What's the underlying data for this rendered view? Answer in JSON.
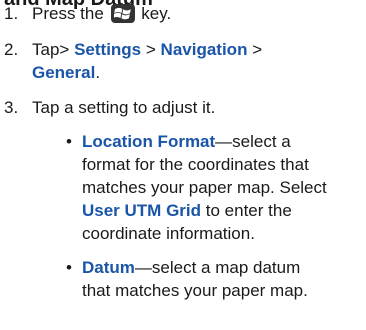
{
  "heading": "and Map Datum",
  "steps": {
    "s1": {
      "num": "1.",
      "pre": "Press the",
      "key_icon": "windows-key-icon",
      "post": "key."
    },
    "s2": {
      "num": "2.",
      "pre": "Tap>",
      "settings": "Settings",
      "sep1": ">",
      "navigation": "Navigation",
      "sep2": ">",
      "general": "General",
      "end": "."
    },
    "s3": {
      "num": "3.",
      "text": "Tap a setting to adjust it."
    }
  },
  "options": {
    "location": {
      "bullet": "•",
      "name": "Location Format",
      "l1": "—select a",
      "l2": "format for the coordinates that",
      "l3": "matches your paper map. Select",
      "grid": "User UTM Grid",
      "l4": "to enter the",
      "l5": "coordinate information."
    },
    "datum": {
      "bullet": "•",
      "name": "Datum",
      "l1": "—select a map datum",
      "l2": "that matches your paper map."
    }
  },
  "colors": {
    "keyword": "#1a55a8",
    "text": "#1a1a1a"
  }
}
